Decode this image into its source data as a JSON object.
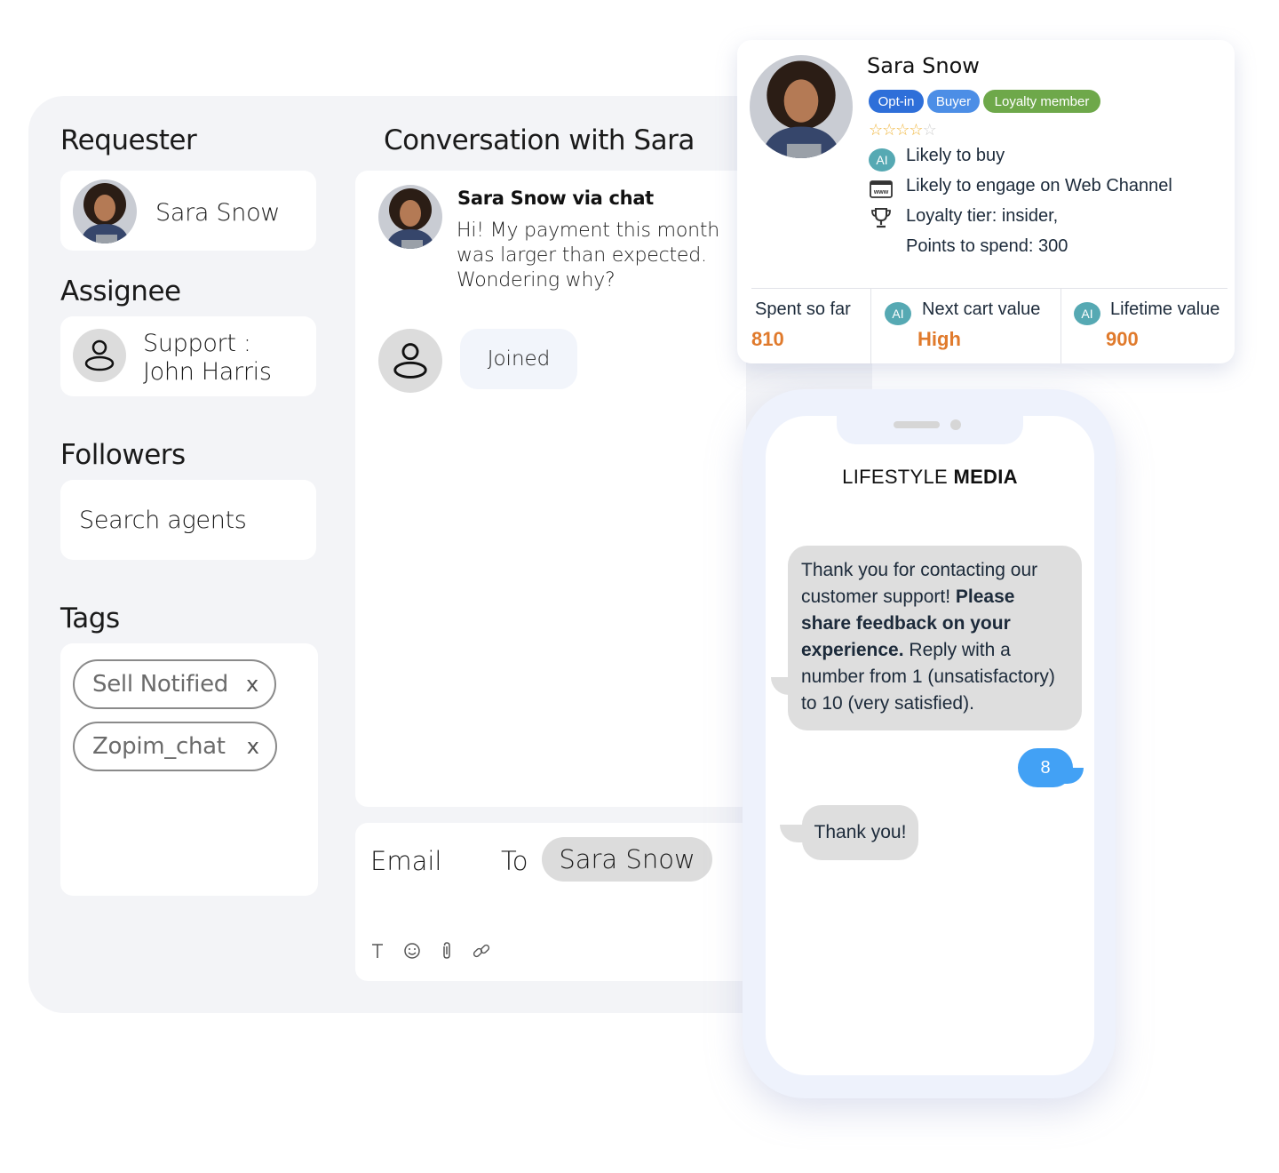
{
  "requester": {
    "heading": "Requester",
    "name": "Sara Snow"
  },
  "assignee": {
    "heading": "Assignee",
    "line1": "Support :",
    "line2": "John Harris"
  },
  "followers": {
    "heading": "Followers",
    "search_placeholder": "Search agents"
  },
  "tags": {
    "heading": "Tags",
    "items": [
      {
        "label": "Sell Notified",
        "remove": "x"
      },
      {
        "label": "Zopim_chat",
        "remove": "x"
      }
    ]
  },
  "conversation": {
    "heading": "Conversation with Sara",
    "messages": [
      {
        "author": "Sara Snow via chat",
        "body": "Hi! My payment this month was larger than expected. Wondering why?"
      }
    ],
    "joined_label": "Joined"
  },
  "composer": {
    "channel": "Email",
    "to_label": "To",
    "recipient": "Sara Snow",
    "toolbar": [
      {
        "icon": "text-format-icon",
        "glyph": "T"
      },
      {
        "icon": "emoji-icon",
        "glyph": "☺"
      },
      {
        "icon": "attachment-icon",
        "glyph": "📎"
      },
      {
        "icon": "link-icon",
        "glyph": "🔗"
      }
    ]
  },
  "profile": {
    "name": "Sara Snow",
    "badges": [
      {
        "label": "Opt-in",
        "color": "#2e6fd9"
      },
      {
        "label": "Buyer",
        "color": "#4c8ee6"
      },
      {
        "label": "Loyalty member",
        "color": "#6ea84a"
      }
    ],
    "rating": {
      "value": 4,
      "max": 5
    },
    "insights": [
      {
        "icon": "ai-icon",
        "ai_label": "AI",
        "text": "Likely to buy"
      },
      {
        "icon": "web-channel-icon",
        "text": "Likely to engage on Web Channel"
      },
      {
        "icon": "trophy-icon",
        "text": "Loyalty tier: insider,"
      },
      {
        "icon": "",
        "text": "Points to spend: 300"
      }
    ],
    "metrics": [
      {
        "label": "Spent so far",
        "value": "810",
        "ai": false
      },
      {
        "label": "Next cart value",
        "value": "High",
        "ai": true,
        "ai_label": "AI"
      },
      {
        "label": "Lifetime value",
        "value": "900",
        "ai": true,
        "ai_label": "AI"
      }
    ],
    "accent_color": "#e07a2c"
  },
  "phone": {
    "brand_light": "LIFESTYLE",
    "brand_bold": "MEDIA",
    "messages": [
      {
        "direction": "in",
        "parts": [
          {
            "text": "Thank you for contacting our customer support! ",
            "bold": false
          },
          {
            "text": "Please share feedback on your experience.",
            "bold": true
          },
          {
            "text": " Reply with a number from 1 (unsatisfactory) to 10 (very satisfied).",
            "bold": false
          }
        ]
      },
      {
        "direction": "out",
        "text": "8"
      },
      {
        "direction": "in",
        "text": "Thank you!"
      }
    ]
  }
}
